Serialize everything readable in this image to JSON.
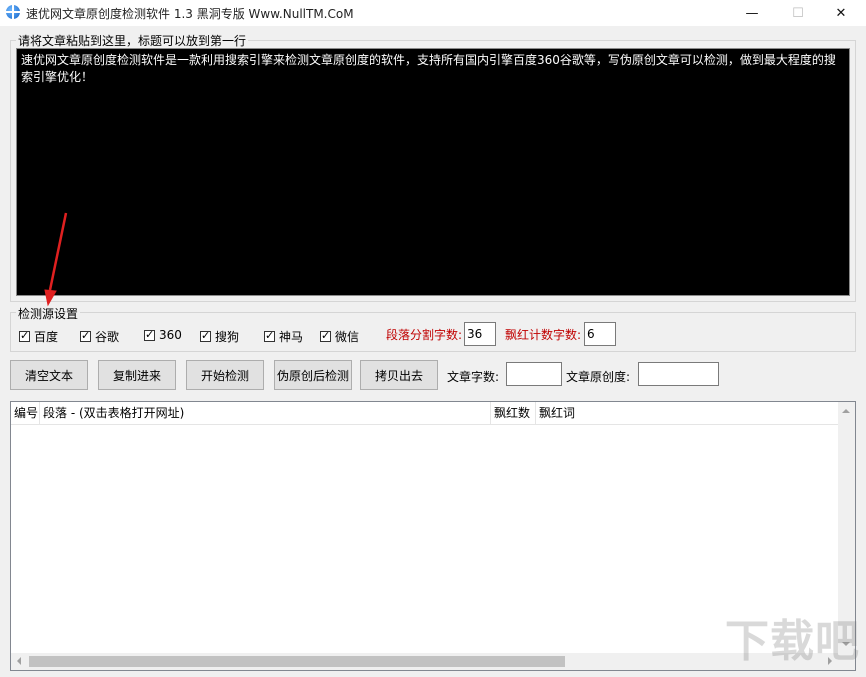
{
  "window": {
    "title": "速优网文章原创度检测软件 1.3    黑洞专版 Www.NullTM.CoM",
    "minimize_glyph": "—",
    "maximize_glyph": "☐",
    "close_glyph": "✕"
  },
  "article": {
    "group_label": "请将文章粘贴到这里，标题可以放到第一行",
    "content": "速优网文章原创度检测软件是一款利用搜索引擎来检测文章原创度的软件，支持所有国内引擎百度360谷歌等，写伪原创文章可以检测，做到最大程度的搜索引擎优化！"
  },
  "sources": {
    "group_label": "检测源设置",
    "items": [
      {
        "label": "百度",
        "checked": true
      },
      {
        "label": "谷歌",
        "checked": true
      },
      {
        "label": "360",
        "checked": true
      },
      {
        "label": "搜狗",
        "checked": true
      },
      {
        "label": "神马",
        "checked": true
      },
      {
        "label": "微信",
        "checked": true
      }
    ],
    "split_label": "段落分割字数:",
    "split_value": "36",
    "red_count_label": "飘红计数字数:",
    "red_count_value": "6"
  },
  "toolbar": {
    "clear_label": "清空文本",
    "paste_label": "复制进来",
    "start_label": "开始检测",
    "pseudo_label": "伪原创后检测",
    "copy_out_label": "拷贝出去",
    "word_count_label": "文章字数:",
    "word_count_value": "",
    "originality_label": "文章原创度:",
    "originality_value": ""
  },
  "table": {
    "columns": [
      "编号",
      "段落 - (双击表格打开网址)",
      "飘红数",
      "飘红词"
    ],
    "rows": []
  },
  "watermark": "下载吧",
  "colors": {
    "accent_red": "#c00000",
    "editor_bg": "#000000",
    "annotation_arrow": "#e02020"
  }
}
